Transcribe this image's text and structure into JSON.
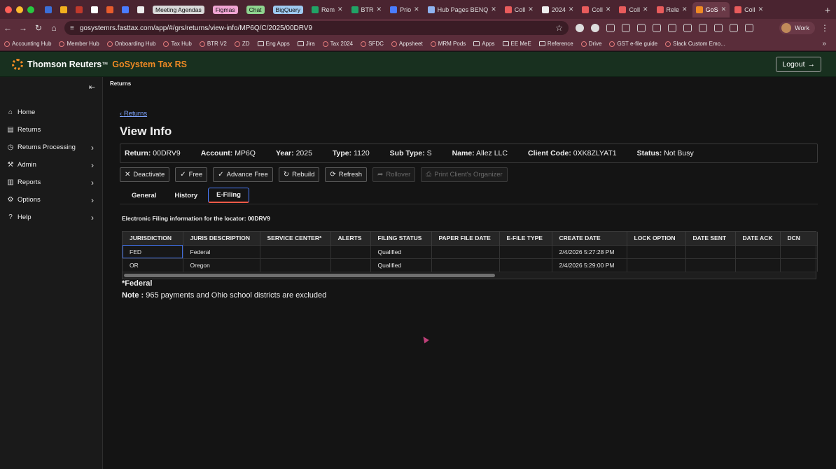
{
  "browser": {
    "tabs": [
      {
        "label": "",
        "icon": "tasks-icon",
        "color": "#3b6fd8"
      },
      {
        "label": "",
        "icon": "drive-icon",
        "color": "#f2b01e"
      },
      {
        "label": "",
        "icon": "chat-icon",
        "color": "#c0392b"
      },
      {
        "label": "",
        "icon": "doc-icon",
        "color": "#ffffff"
      },
      {
        "label": "",
        "icon": "home-icon",
        "color": "#e85c2c"
      },
      {
        "label": "",
        "icon": "wave-icon",
        "color": "#4a7cff"
      },
      {
        "label": "",
        "icon": "note-icon",
        "color": "#eeeeee"
      }
    ],
    "pill_tabs": [
      {
        "label": "Meeting Agendas",
        "color": "#d9d9d9"
      },
      {
        "label": "Figmas",
        "color": "#f0a5d3"
      },
      {
        "label": "Chat",
        "color": "#8fd48f"
      },
      {
        "label": "BigQuery",
        "color": "#9ec9f0"
      }
    ],
    "titled_tabs": [
      {
        "label": "Rem",
        "color": "#21a366"
      },
      {
        "label": "BTR",
        "color": "#21a366"
      },
      {
        "label": "Prio",
        "color": "#4a7cff"
      },
      {
        "label": "Hub Pages BENQ",
        "color": "#8fb3f0"
      },
      {
        "label": "Coll",
        "color": "#e85c5c"
      },
      {
        "label": "2024",
        "color": "#eeeeee"
      },
      {
        "label": "Coll",
        "color": "#e85c5c"
      },
      {
        "label": "Coll",
        "color": "#e85c5c"
      },
      {
        "label": "Rele",
        "color": "#e85c5c"
      },
      {
        "label": "GoS",
        "color": "#f08a24",
        "active": true
      },
      {
        "label": "Coll",
        "color": "#e85c5c"
      }
    ],
    "url": "gosystemrs.fasttax.com/app/#/grs/returns/view-info/MP6Q/C/2025/00DRV9",
    "profile_label": "Work",
    "bookmarks": [
      {
        "label": "Accounting Hub",
        "type": "site"
      },
      {
        "label": "Member Hub",
        "type": "site"
      },
      {
        "label": "Onboarding Hub",
        "type": "site"
      },
      {
        "label": "Tax Hub",
        "type": "site"
      },
      {
        "label": "BTR V2",
        "type": "site"
      },
      {
        "label": "ZD",
        "type": "site"
      },
      {
        "label": "Eng Apps",
        "type": "folder"
      },
      {
        "label": "Jira",
        "type": "folder"
      },
      {
        "label": "Tax 2024",
        "type": "site"
      },
      {
        "label": "SFDC",
        "type": "site"
      },
      {
        "label": "Appsheet",
        "type": "site"
      },
      {
        "label": "MRM Pods",
        "type": "site"
      },
      {
        "label": "Apps",
        "type": "folder"
      },
      {
        "label": "EE MeE",
        "type": "folder"
      },
      {
        "label": "Reference",
        "type": "folder"
      },
      {
        "label": "Drive",
        "type": "site"
      },
      {
        "label": "GST e-file guide",
        "type": "site"
      },
      {
        "label": "Slack Custom Emo...",
        "type": "site"
      }
    ],
    "bookmarks_more": "»"
  },
  "header": {
    "brand": "Thomson Reuters",
    "brand_mark": "™",
    "product": "GoSystem Tax RS",
    "logout_label": "Logout",
    "logout_icon": "→"
  },
  "sidebar": {
    "collapse_icon": "⇤",
    "items": [
      {
        "label": "Home",
        "icon": "⌂",
        "expandable": false
      },
      {
        "label": "Returns",
        "icon": "▤",
        "expandable": false
      },
      {
        "label": "Returns Processing",
        "icon": "◷",
        "expandable": true
      },
      {
        "label": "Admin",
        "icon": "⚒",
        "expandable": true
      },
      {
        "label": "Reports",
        "icon": "▥",
        "expandable": true
      },
      {
        "label": "Options",
        "icon": "⚙",
        "expandable": true
      },
      {
        "label": "Help",
        "icon": "?",
        "expandable": true
      }
    ]
  },
  "main": {
    "breadcrumb": "Returns",
    "back_link": "Returns",
    "title": "View Info",
    "info": [
      {
        "key": "Return:",
        "value": "00DRV9"
      },
      {
        "key": "Account:",
        "value": "MP6Q"
      },
      {
        "key": "Year:",
        "value": "2025"
      },
      {
        "key": "Type:",
        "value": "1120"
      },
      {
        "key": "Sub Type:",
        "value": "S"
      },
      {
        "key": "Name:",
        "value": "Allez LLC"
      },
      {
        "key": "Client Code:",
        "value": "0XK8ZLYAT1"
      },
      {
        "key": "Status:",
        "value": "Not Busy"
      }
    ],
    "actions": [
      {
        "label": "Deactivate",
        "icon": "✕",
        "disabled": false
      },
      {
        "label": "Free",
        "icon": "✓",
        "disabled": false
      },
      {
        "label": "Advance Free",
        "icon": "✓",
        "disabled": false
      },
      {
        "label": "Rebuild",
        "icon": "↻",
        "disabled": false
      },
      {
        "label": "Refresh",
        "icon": "⟳",
        "disabled": false
      },
      {
        "label": "Rollover",
        "icon": "➦",
        "disabled": true
      },
      {
        "label": "Print Client's Organizer",
        "icon": "⎙",
        "disabled": true
      }
    ],
    "tabs": [
      {
        "label": "General",
        "active": false
      },
      {
        "label": "History",
        "active": false
      },
      {
        "label": "E-Filing",
        "active": true
      }
    ],
    "efile_caption": "Electronic Filing information for the locator: 00DRV9",
    "table": {
      "columns": [
        "JURISDICTION",
        "JURIS DESCRIPTION",
        "SERVICE CENTER*",
        "ALERTS",
        "FILING STATUS",
        "PAPER FILE DATE",
        "E-FILE TYPE",
        "CREATE DATE",
        "LOCK OPTION",
        "DATE SENT",
        "DATE ACK",
        "DCN"
      ],
      "rows": [
        [
          "FED",
          "Federal",
          "",
          "",
          "Qualified",
          "",
          "",
          "2/4/2026 5:27:28 PM",
          "",
          "",
          "",
          ""
        ],
        [
          "OR",
          "Oregon",
          "",
          "",
          "Qualified",
          "",
          "",
          "2/4/2026 5:29:00 PM",
          "",
          "",
          "",
          ""
        ]
      ]
    },
    "footnote": "*Federal",
    "note_label": "Note :",
    "note_text": " 965 payments and Ohio school districts are excluded"
  }
}
